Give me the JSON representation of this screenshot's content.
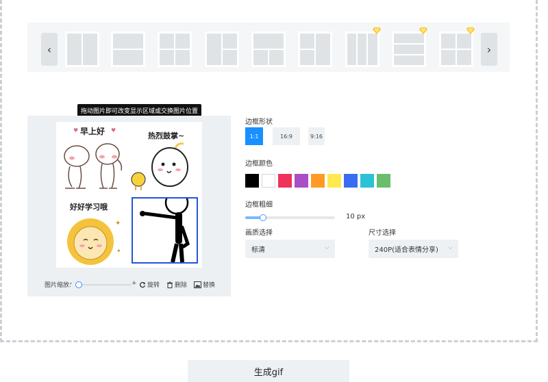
{
  "layout_scroller": {
    "prev_icon": "chevron-left-icon",
    "next_icon": "chevron-right-icon",
    "vip_icon": "diamond-icon",
    "vip_color": "#f7c51b"
  },
  "editor": {
    "tooltip": "拖动图片即可改变显示区域或交换图片位置",
    "stickers": {
      "s1_text": "早上好",
      "s2_text": "热烈鼓掌~",
      "s3_text": "好好学习哦"
    },
    "toolbar": {
      "zoom_label": "图片缩放:",
      "zoom_minus": "-",
      "zoom_plus": "+",
      "rotate_label": "旋转",
      "delete_label": "删除",
      "replace_label": "替换"
    }
  },
  "settings": {
    "shape_label": "边框形状",
    "ratios": [
      "1:1",
      "16:9",
      "9:16"
    ],
    "active_ratio": "1:1",
    "color_label": "边框颜色",
    "colors": [
      "#000000",
      "#ffffff",
      "#f0325a",
      "#a94ec6",
      "#ff9a24",
      "#ffe94f",
      "#3a6cf2",
      "#2bc1d6",
      "#6bbd6e"
    ],
    "thickness_label": "边框粗细",
    "thickness_value": "10 px",
    "quality_label": "画质选择",
    "quality_value": "标清",
    "size_label": "尺寸选择",
    "size_value": "240P(适合表情分享)"
  },
  "generate_button": "生成gif"
}
